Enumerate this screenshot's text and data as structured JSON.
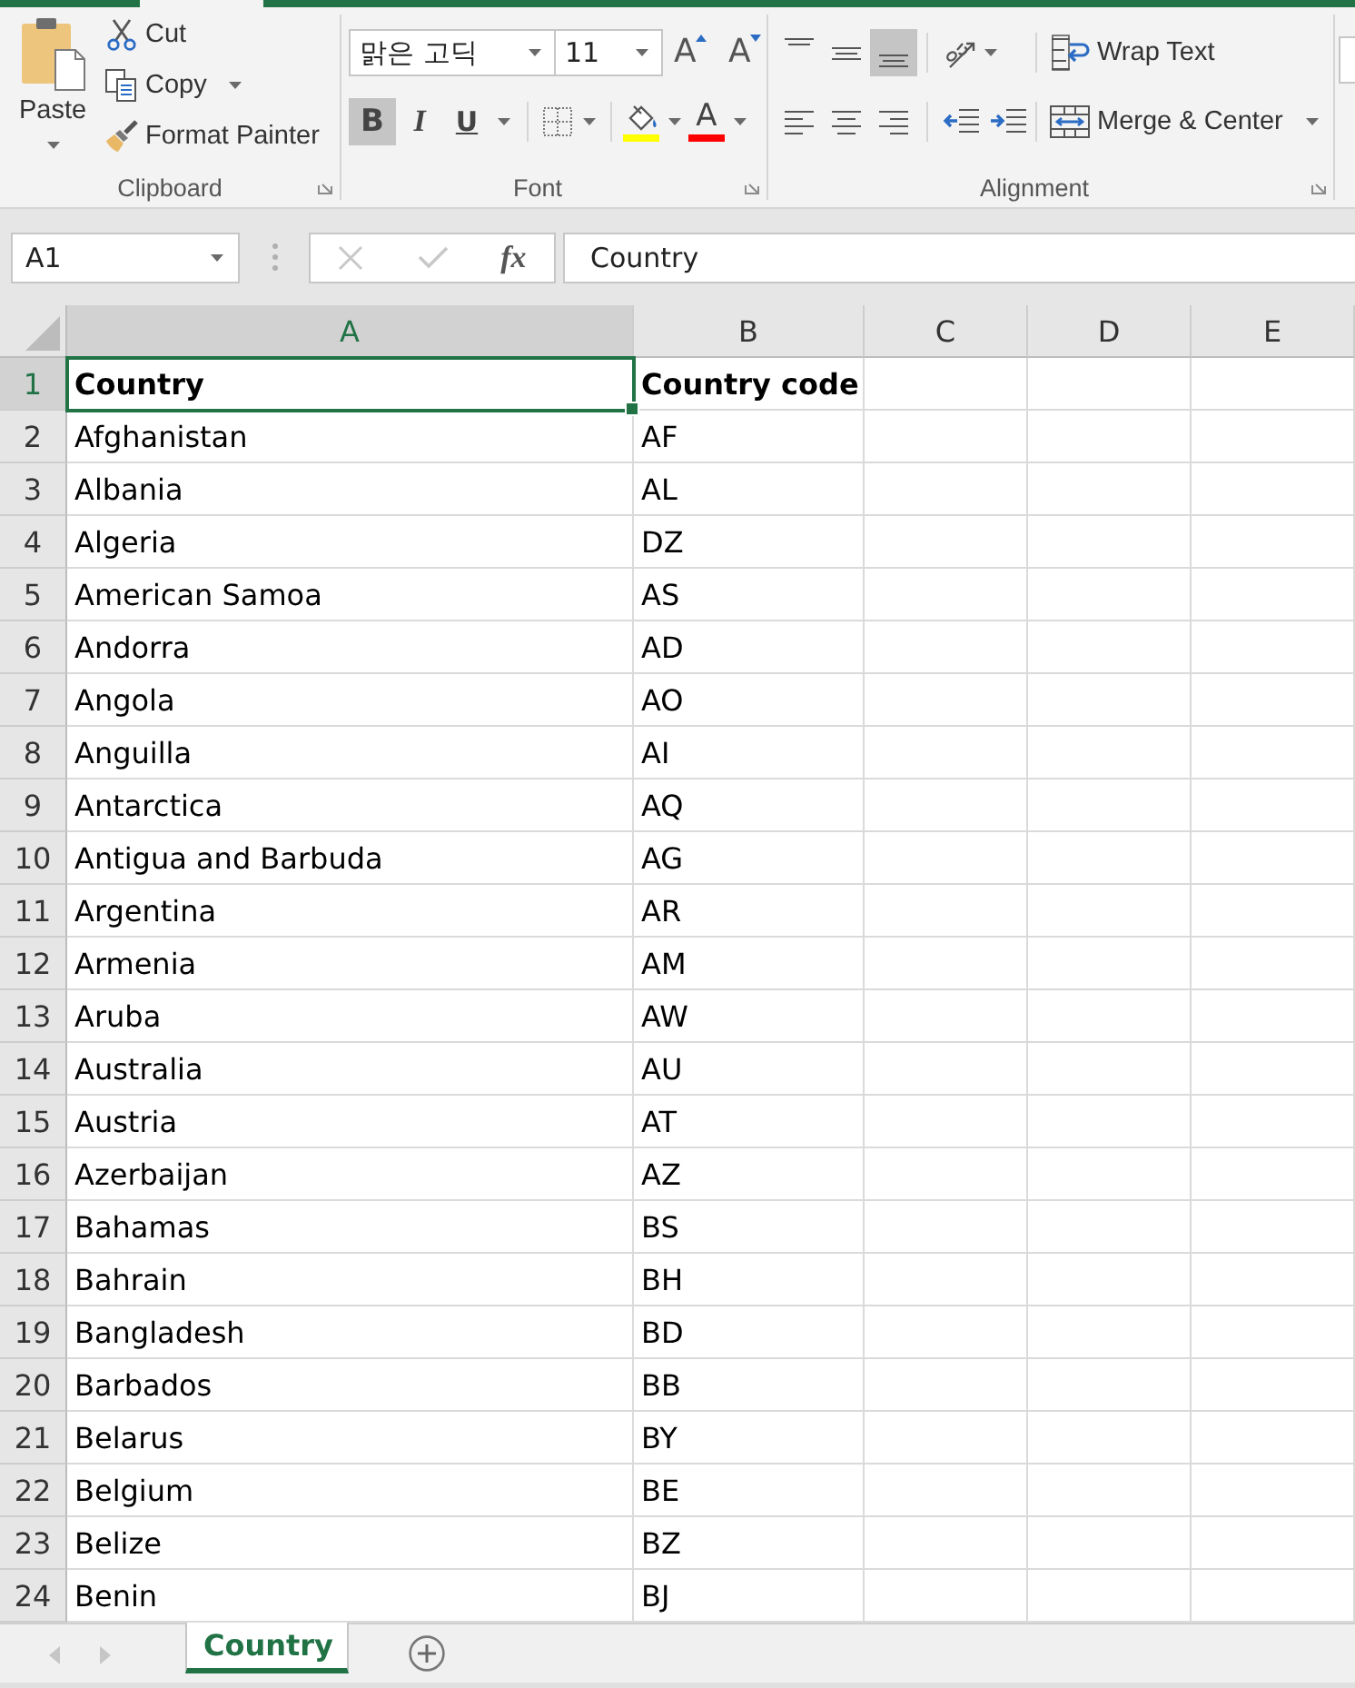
{
  "ribbon": {
    "clipboard": {
      "label": "Clipboard",
      "paste": "Paste",
      "cut": "Cut",
      "copy": "Copy",
      "format_painter": "Format Painter"
    },
    "font": {
      "label": "Font",
      "font_name": "맑은 고딕",
      "font_size": "11",
      "grow_font": "A",
      "shrink_font": "A",
      "styles": [
        {
          "kind": "bold",
          "label": "B",
          "selected": true
        },
        {
          "kind": "italic",
          "label": "I",
          "selected": false
        },
        {
          "kind": "underline",
          "label": "U",
          "selected": false
        }
      ],
      "color_buttons": [
        {
          "kind": "fill",
          "color": "#ffff00"
        },
        {
          "kind": "font",
          "label": "A",
          "color": "#ff0000"
        }
      ]
    },
    "alignment": {
      "label": "Alignment",
      "vertical": [
        {
          "kind": "top",
          "selected": false
        },
        {
          "kind": "middle",
          "selected": false
        },
        {
          "kind": "bottom",
          "selected": true
        }
      ],
      "horizontal": [
        {
          "kind": "left",
          "selected": false
        },
        {
          "kind": "center",
          "selected": false
        },
        {
          "kind": "right",
          "selected": false
        }
      ],
      "wrap_text": "Wrap Text",
      "merge_center": "Merge & Center"
    }
  },
  "formula_bar": {
    "name_box": "A1",
    "buttons": [
      {
        "kind": "cancel",
        "disabled": true
      },
      {
        "kind": "enter",
        "disabled": true
      },
      {
        "kind": "function",
        "label": "fx",
        "disabled": false
      }
    ],
    "formula": "Country"
  },
  "sheet": {
    "columns": [
      {
        "label": "A",
        "selected": true
      },
      {
        "label": "B",
        "selected": false
      },
      {
        "label": "C",
        "selected": false
      },
      {
        "label": "D",
        "selected": false
      },
      {
        "label": "E",
        "selected": false
      }
    ],
    "rows": [
      {
        "number": "1",
        "selected": true,
        "bold": true,
        "cells": [
          "Country",
          "Country code"
        ]
      },
      {
        "number": "2",
        "selected": false,
        "bold": false,
        "cells": [
          "Afghanistan",
          "AF"
        ]
      },
      {
        "number": "3",
        "selected": false,
        "bold": false,
        "cells": [
          "Albania",
          "AL"
        ]
      },
      {
        "number": "4",
        "selected": false,
        "bold": false,
        "cells": [
          "Algeria",
          "DZ"
        ]
      },
      {
        "number": "5",
        "selected": false,
        "bold": false,
        "cells": [
          "American Samoa",
          "AS"
        ]
      },
      {
        "number": "6",
        "selected": false,
        "bold": false,
        "cells": [
          "Andorra",
          "AD"
        ]
      },
      {
        "number": "7",
        "selected": false,
        "bold": false,
        "cells": [
          "Angola",
          "AO"
        ]
      },
      {
        "number": "8",
        "selected": false,
        "bold": false,
        "cells": [
          "Anguilla",
          "AI"
        ]
      },
      {
        "number": "9",
        "selected": false,
        "bold": false,
        "cells": [
          "Antarctica",
          "AQ"
        ]
      },
      {
        "number": "10",
        "selected": false,
        "bold": false,
        "cells": [
          "Antigua and Barbuda",
          "AG"
        ]
      },
      {
        "number": "11",
        "selected": false,
        "bold": false,
        "cells": [
          "Argentina",
          "AR"
        ]
      },
      {
        "number": "12",
        "selected": false,
        "bold": false,
        "cells": [
          "Armenia",
          "AM"
        ]
      },
      {
        "number": "13",
        "selected": false,
        "bold": false,
        "cells": [
          "Aruba",
          "AW"
        ]
      },
      {
        "number": "14",
        "selected": false,
        "bold": false,
        "cells": [
          "Australia",
          "AU"
        ]
      },
      {
        "number": "15",
        "selected": false,
        "bold": false,
        "cells": [
          "Austria",
          "AT"
        ]
      },
      {
        "number": "16",
        "selected": false,
        "bold": false,
        "cells": [
          "Azerbaijan",
          "AZ"
        ]
      },
      {
        "number": "17",
        "selected": false,
        "bold": false,
        "cells": [
          "Bahamas",
          "BS"
        ]
      },
      {
        "number": "18",
        "selected": false,
        "bold": false,
        "cells": [
          "Bahrain",
          "BH"
        ]
      },
      {
        "number": "19",
        "selected": false,
        "bold": false,
        "cells": [
          "Bangladesh",
          "BD"
        ]
      },
      {
        "number": "20",
        "selected": false,
        "bold": false,
        "cells": [
          "Barbados",
          "BB"
        ]
      },
      {
        "number": "21",
        "selected": false,
        "bold": false,
        "cells": [
          "Belarus",
          "BY"
        ]
      },
      {
        "number": "22",
        "selected": false,
        "bold": false,
        "cells": [
          "Belgium",
          "BE"
        ]
      },
      {
        "number": "23",
        "selected": false,
        "bold": false,
        "cells": [
          "Belize",
          "BZ"
        ]
      },
      {
        "number": "24",
        "selected": false,
        "bold": false,
        "cells": [
          "Benin",
          "BJ"
        ]
      }
    ]
  },
  "sheet_tabs": [
    {
      "label": "Country",
      "selected": true
    }
  ]
}
